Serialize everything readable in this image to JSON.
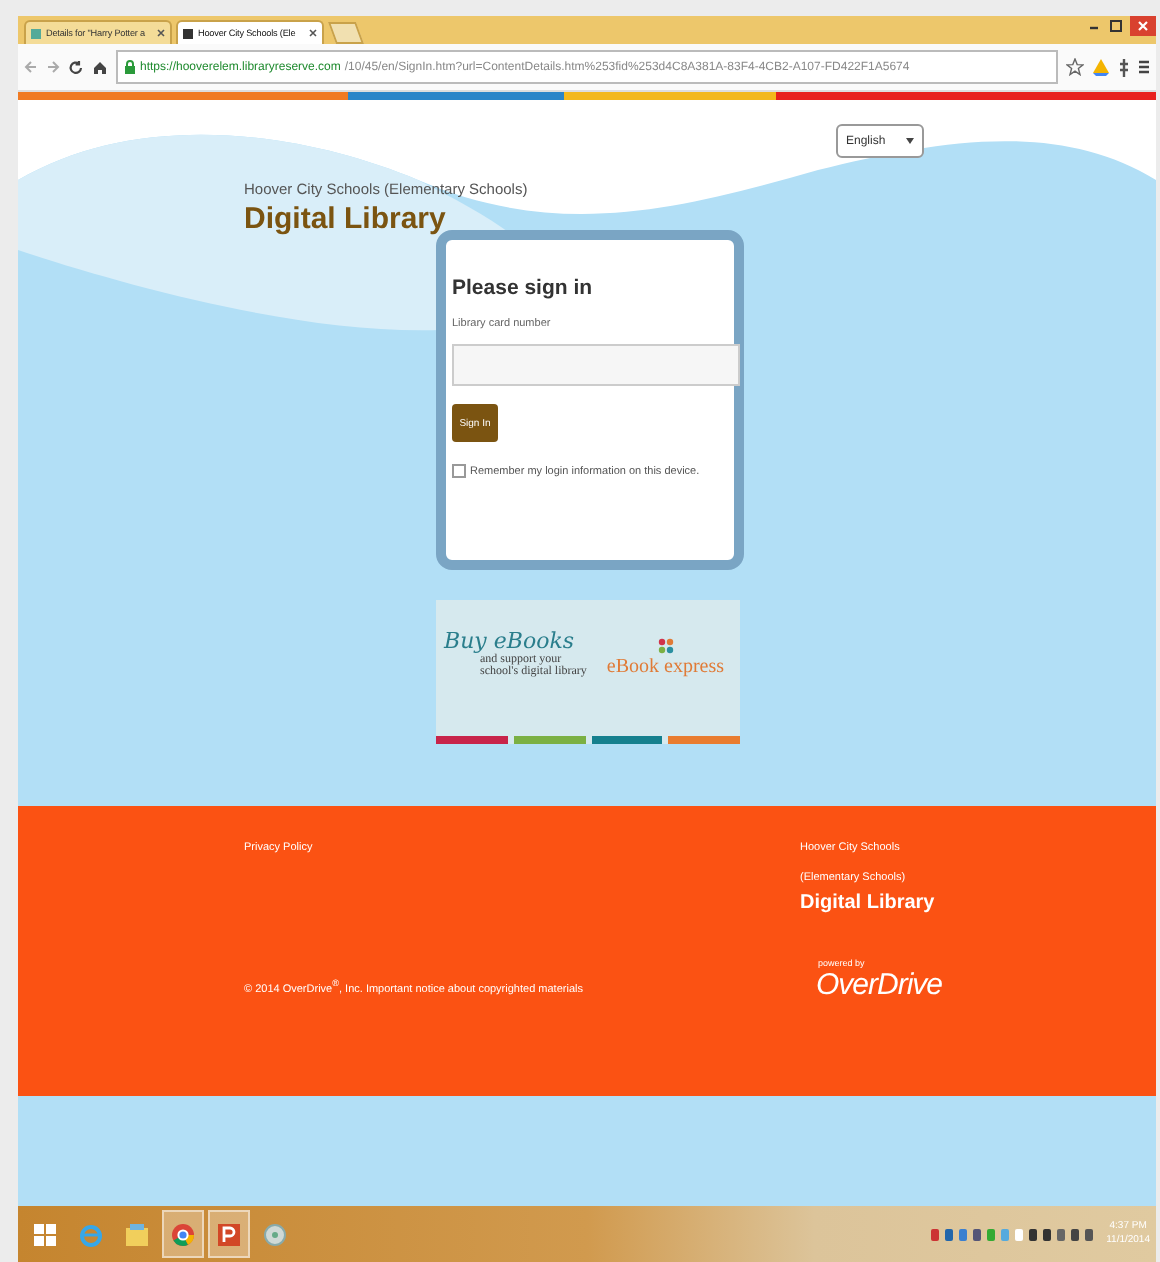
{
  "browser": {
    "tabs": [
      {
        "title": "Details for \"Harry Potter a",
        "selected": false
      },
      {
        "title": "Hoover City Schools (Ele",
        "selected": true
      }
    ],
    "url_host": "https://hooverelem.libraryreserve.com",
    "url_path": "/10/45/en/SignIn.htm?url=ContentDetails.htm%253fid%253d4C8A381A-83F4-4CB2-A107-FD422F1A5674"
  },
  "language_select": {
    "value": "English"
  },
  "header": {
    "org": "Hoover City Schools (Elementary Schools)",
    "title": "Digital Library"
  },
  "signin": {
    "heading": "Please sign in",
    "field_label": "Library card number",
    "button": "Sign In",
    "remember": {
      "label": "Remember my login information on this device.",
      "checked": false
    }
  },
  "banner": {
    "script_text": "Buy eBooks",
    "line1": "and support your",
    "line2": "school's digital library",
    "brand": "eBook express"
  },
  "footer": {
    "privacy": "Privacy Policy",
    "copyright": "© 2014 OverDrive$^{®}$, Inc.",
    "notice_link": "Important notice about copyrighted materials",
    "org_line1": "Hoover City Schools",
    "org_line2": "(Elementary Schools)",
    "title": "Digital Library",
    "powered_by": "powered by",
    "brand": "OverDrive"
  },
  "taskbar": {
    "apps": [
      {
        "kind": "start",
        "selected": false
      },
      {
        "kind": "ie",
        "selected": false
      },
      {
        "kind": "files",
        "selected": false
      },
      {
        "kind": "chrome",
        "selected": true
      },
      {
        "kind": "powerpoint",
        "selected": true
      },
      {
        "kind": "media",
        "selected": false
      }
    ],
    "time": "4:37 PM",
    "date": "11/1/2014"
  }
}
